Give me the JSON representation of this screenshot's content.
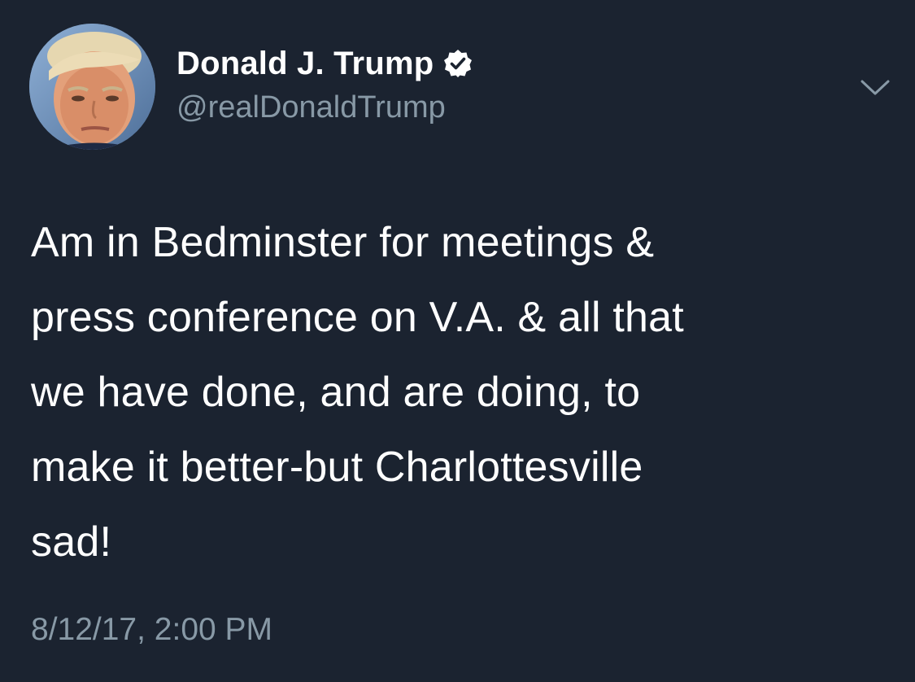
{
  "user": {
    "display_name": "Donald J. Trump",
    "handle": "@realDonaldTrump",
    "verified": true,
    "avatar_icon": "profile-photo"
  },
  "tweet": {
    "lines": [
      "Am in Bedminster for meetings &",
      "press conference on V.A. & all that",
      "we have done, and are doing, to",
      "make it better-but Charlottesville",
      "sad!"
    ],
    "timestamp": "8/12/17, 2:00 PM"
  },
  "icons": {
    "verified": "verified-badge-icon",
    "menu": "chevron-down-icon"
  },
  "colors": {
    "background": "#1b2330",
    "text_primary": "#ffffff",
    "text_secondary": "#8899a6"
  }
}
